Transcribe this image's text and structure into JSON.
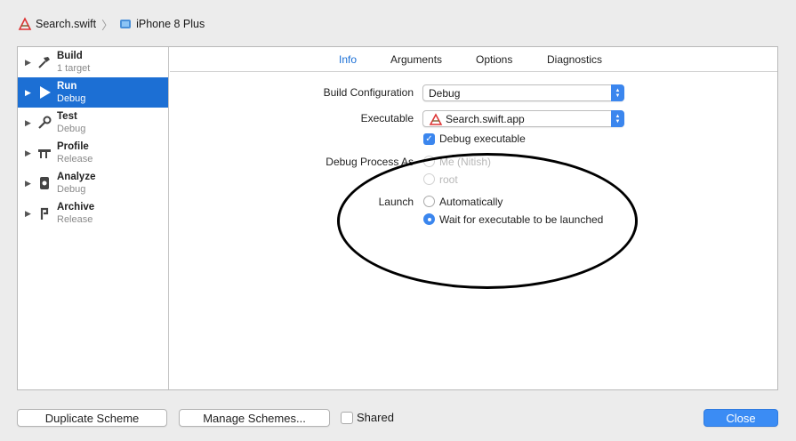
{
  "breadcrumb": {
    "project": "Search.swift",
    "device": "iPhone 8 Plus"
  },
  "sidebar": {
    "items": [
      {
        "title": "Build",
        "subtitle": "1 target",
        "icon": "hammer-icon",
        "selected": false
      },
      {
        "title": "Run",
        "subtitle": "Debug",
        "icon": "play-icon",
        "selected": true
      },
      {
        "title": "Test",
        "subtitle": "Debug",
        "icon": "wrench-icon",
        "selected": false
      },
      {
        "title": "Profile",
        "subtitle": "Release",
        "icon": "profile-icon",
        "selected": false
      },
      {
        "title": "Analyze",
        "subtitle": "Debug",
        "icon": "analyze-icon",
        "selected": false
      },
      {
        "title": "Archive",
        "subtitle": "Release",
        "icon": "archive-icon",
        "selected": false
      }
    ]
  },
  "tabs": [
    "Info",
    "Arguments",
    "Options",
    "Diagnostics"
  ],
  "active_tab": "Info",
  "info": {
    "build_config_label": "Build Configuration",
    "build_config_value": "Debug",
    "executable_label": "Executable",
    "executable_value": "Search.swift.app",
    "debug_executable_label": "Debug executable",
    "debug_executable_checked": true,
    "debug_process_as_label": "Debug Process As",
    "debug_process_options": [
      "Me (Nitish)",
      "root"
    ],
    "launch_label": "Launch",
    "launch_options": [
      "Automatically",
      "Wait for executable to be launched"
    ],
    "launch_selected": "Wait for executable to be launched"
  },
  "footer": {
    "duplicate_label": "Duplicate Scheme",
    "manage_label": "Manage Schemes...",
    "shared_label": "Shared",
    "shared_checked": false,
    "close_label": "Close"
  },
  "colors": {
    "accent": "#3b86ee",
    "selection": "#1c6fd4"
  }
}
